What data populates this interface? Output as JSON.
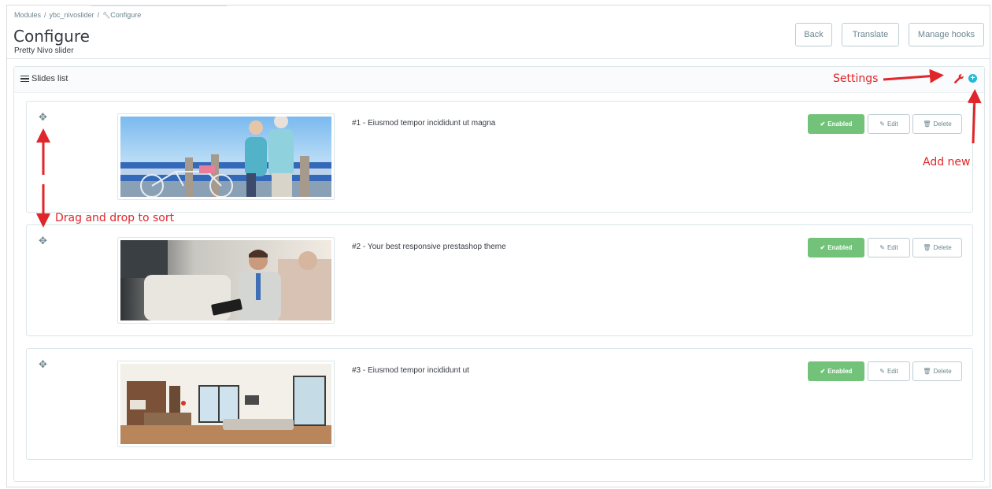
{
  "breadcrumb": {
    "modules": "Modules",
    "module": "ybc_nivoslider",
    "current": "Configure",
    "separator": "/"
  },
  "header": {
    "title": "Configure",
    "subtitle": "Pretty Nivo slider",
    "back_label": "Back",
    "translate_label": "Translate",
    "manage_hooks_label": "Manage hooks"
  },
  "panel": {
    "title": "Slides list",
    "settings_icon": "wrench-icon",
    "add_icon": "plus-circle-icon"
  },
  "slides": [
    {
      "title": "#1 - Eiusmod tempor incididunt ut magna",
      "status_label": "Enabled",
      "edit_label": "Edit",
      "delete_label": "Delete"
    },
    {
      "title": "#2 - Your best responsive prestashop theme",
      "status_label": "Enabled",
      "edit_label": "Edit",
      "delete_label": "Delete"
    },
    {
      "title": "#3 - Eiusmod tempor incididunt ut",
      "status_label": "Enabled",
      "edit_label": "Edit",
      "delete_label": "Delete"
    }
  ],
  "annotations": {
    "settings": "Settings",
    "add_new": "Add new",
    "drag_sort": "Drag and drop to sort"
  },
  "colors": {
    "enabled_green": "#72c279",
    "accent_blue": "#25b9d7",
    "annotation_red": "#e0262a"
  }
}
